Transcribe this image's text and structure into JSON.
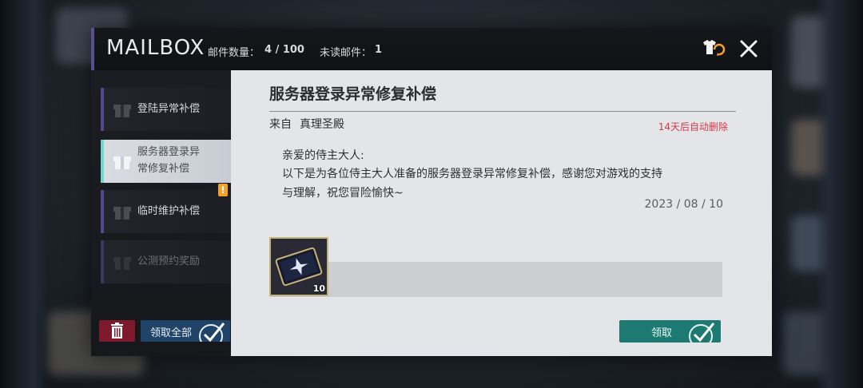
{
  "header": {
    "title": "MAILBOX",
    "mail_count_label": "邮件数量：",
    "mail_count_value": "4 / 100",
    "unread_label": "未读邮件：",
    "unread_value": "1",
    "icons": [
      "shirt-refresh-icon",
      "close-icon"
    ]
  },
  "sidebar": {
    "items": [
      {
        "label": "登陆异常补偿",
        "state": "unread"
      },
      {
        "label_line1": "服务器登录异",
        "label_line2": "常修复补偿",
        "state": "selected"
      },
      {
        "label": "临时维护补偿",
        "state": "unread",
        "badge": "!"
      },
      {
        "label": "公测预约奖励",
        "state": "read"
      }
    ],
    "claim_all_label": "领取全部",
    "delete_icon": "trash-icon"
  },
  "mail": {
    "title": "服务器登录异常修复补偿",
    "sender_prefix": "来自",
    "sender_name": "真理圣殿",
    "expiry": "14天后自动删除",
    "greeting": "亲爱的侍主大人:",
    "body_line1": "以下是为各位侍主大人准备的服务器登录异常修复补偿，感谢您对游戏的支持",
    "body_line2": "与理解，祝您冒险愉快~",
    "date": "2023 / 08 / 10",
    "attachments": [
      {
        "icon": "ticket-icon",
        "quantity": "10"
      }
    ],
    "claim_label": "领取"
  },
  "colors": {
    "accent_purple": "#5c4d8c",
    "selected_bar": "#6fd6d0",
    "badge": "#f2a22b",
    "delete": "#7e1a2b",
    "claim_all": "#1f4468",
    "claim": "#1d7a72",
    "expiry_red": "#d23a4a"
  }
}
